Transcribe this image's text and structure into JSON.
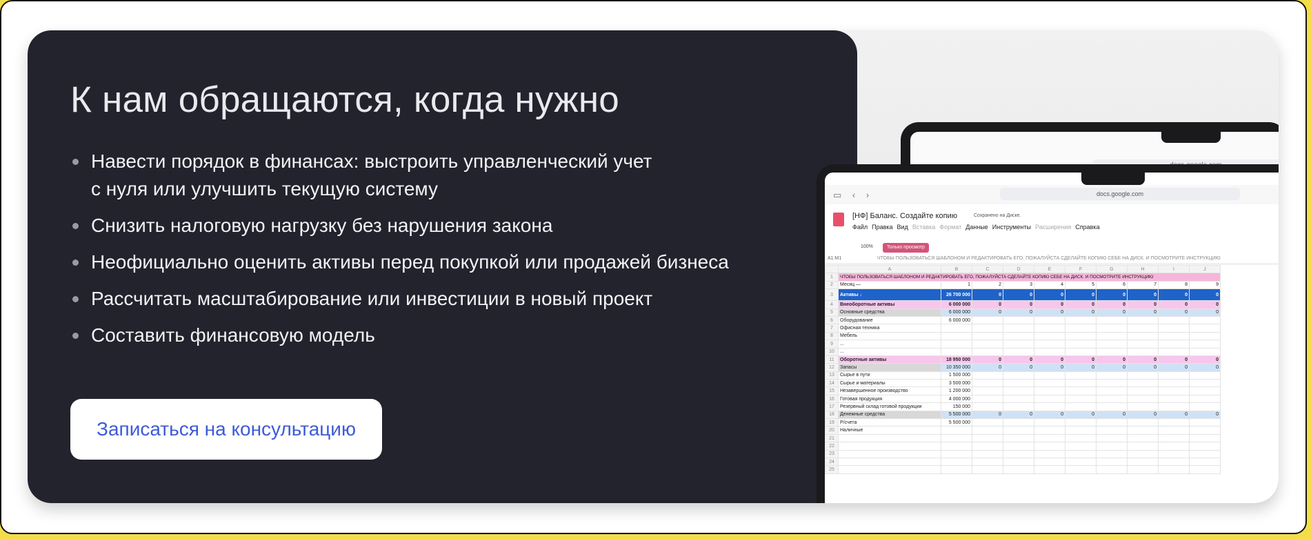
{
  "hero": {
    "title": "К нам обращаются, когда нужно",
    "bullets": [
      "Навести порядок в финансах: выстроить управленческий учет\nс нуля или улучшить текущую систему",
      "Снизить налоговую нагрузку без нарушения закона",
      "Неофициально оценить активы перед покупкой или продажей бизнеса",
      "Рассчитать масштабирование или инвестиции в новый проект",
      "Составить финансовую модель"
    ],
    "cta_label": "Записаться на консультацию"
  },
  "colors": {
    "background": "#f4dc4a",
    "panel": "#22232d",
    "cta_text": "#3d5bd8",
    "sheet_blue": "#1f63c9",
    "sheet_pink": "#f7c6ec",
    "view_only_badge": "#d4547a"
  },
  "laptop_back": {
    "url": "docs.google.com"
  },
  "spreadsheet": {
    "url": "docs.google.com",
    "doc_title": "[НФ] Баланс. Создайте копию",
    "saved_status": "Сохранено на Диске.",
    "menu": [
      "Файл",
      "Правка",
      "Вид",
      "Вставка",
      "Формат",
      "Данные",
      "Инструменты",
      "Расширения",
      "Справка"
    ],
    "zoom": "100%",
    "view_only": "Только просмотр",
    "cell_ref": "A1:M1",
    "formula_text": "ЧТОБЫ ПОЛЬЗОВАТЬСЯ ШАБЛОНОМ И РЕДАКТИРОВАТЬ ЕГО, ПОЖАЛУЙСТА СДЕЛАЙТЕ КОПИЮ СЕБЕ НА ДИСК. И ПОСМОТРИТЕ ИНСТРУКЦИЮ",
    "columns": [
      "A",
      "B",
      "C",
      "D",
      "E",
      "F",
      "G",
      "H",
      "I",
      "J"
    ],
    "banner": "ЧТОБЫ ПОЛЬЗОВАТЬСЯ ШАБЛОНОМ И РЕДАКТИРОВАТЬ ЕГО, ПОЖАЛУЙСТА СДЕЛАЙТЕ КОПИЮ СЕБЕ НА ДИСК. И ПОСМОТРИТЕ ИНСТРУКЦИЮ",
    "rows": [
      {
        "n": "2",
        "style": "month",
        "label": "Месяц —",
        "cells": [
          "1",
          "2",
          "3",
          "4",
          "5",
          "6",
          "7",
          "8",
          "9"
        ]
      },
      {
        "n": "3",
        "style": "assets",
        "label": "Активы ↓",
        "cells": [
          "26 700 000",
          "0",
          "0",
          "0",
          "0",
          "0",
          "0",
          "0",
          "0"
        ]
      },
      {
        "n": "4",
        "style": "pink",
        "label": "Внеоборотные активы",
        "cells": [
          "6 000 000",
          "0",
          "0",
          "0",
          "0",
          "0",
          "0",
          "0",
          "0"
        ]
      },
      {
        "n": "5",
        "style": "blue",
        "label": "Основные средства",
        "cells": [
          "6 000 000",
          "0",
          "0",
          "0",
          "0",
          "0",
          "0",
          "0",
          "0"
        ]
      },
      {
        "n": "6",
        "style": "plain",
        "label": "Оборудование",
        "cells": [
          "6 000 000",
          "",
          "",
          "",
          "",
          "",
          "",
          "",
          ""
        ]
      },
      {
        "n": "7",
        "style": "plain",
        "label": "Офисная техника",
        "cells": [
          "",
          "",
          "",
          "",
          "",
          "",
          "",
          "",
          ""
        ]
      },
      {
        "n": "8",
        "style": "plain",
        "label": "Мебель",
        "cells": [
          "",
          "",
          "",
          "",
          "",
          "",
          "",
          "",
          ""
        ]
      },
      {
        "n": "9",
        "style": "plain",
        "label": "...",
        "cells": [
          "",
          "",
          "",
          "",
          "",
          "",
          "",
          "",
          ""
        ]
      },
      {
        "n": "10",
        "style": "plain",
        "label": "...",
        "cells": [
          "",
          "",
          "",
          "",
          "",
          "",
          "",
          "",
          ""
        ]
      },
      {
        "n": "11",
        "style": "pink",
        "label": "Оборотные активы",
        "cells": [
          "18 950 000",
          "0",
          "0",
          "0",
          "0",
          "0",
          "0",
          "0",
          "0"
        ]
      },
      {
        "n": "12",
        "style": "blue",
        "label": "Запасы",
        "cells": [
          "10 350 000",
          "0",
          "0",
          "0",
          "0",
          "0",
          "0",
          "0",
          "0"
        ]
      },
      {
        "n": "13",
        "style": "plain",
        "label": "Сырье в пути",
        "cells": [
          "1 500 000",
          "",
          "",
          "",
          "",
          "",
          "",
          "",
          ""
        ]
      },
      {
        "n": "14",
        "style": "plain",
        "label": "Сырье и материалы",
        "cells": [
          "3 500 000",
          "",
          "",
          "",
          "",
          "",
          "",
          "",
          ""
        ]
      },
      {
        "n": "15",
        "style": "plain",
        "label": "Незавершенное производство",
        "cells": [
          "1 200 000",
          "",
          "",
          "",
          "",
          "",
          "",
          "",
          ""
        ]
      },
      {
        "n": "16",
        "style": "plain",
        "label": "Готовая продукция",
        "cells": [
          "4 000 000",
          "",
          "",
          "",
          "",
          "",
          "",
          "",
          ""
        ]
      },
      {
        "n": "17",
        "style": "plain",
        "label": "Резервный склад готовой продукции",
        "cells": [
          "150 000",
          "",
          "",
          "",
          "",
          "",
          "",
          "",
          ""
        ]
      },
      {
        "n": "18",
        "style": "blue",
        "label": "Денежные средства",
        "cells": [
          "5 500 000",
          "0",
          "0",
          "0",
          "0",
          "0",
          "0",
          "0",
          "0"
        ]
      },
      {
        "n": "19",
        "style": "plain",
        "label": "Р/счета",
        "cells": [
          "5 500 000",
          "",
          "",
          "",
          "",
          "",
          "",
          "",
          ""
        ]
      },
      {
        "n": "20",
        "style": "plain",
        "label": "Наличные",
        "cells": [
          "",
          "",
          "",
          "",
          "",
          "",
          "",
          "",
          ""
        ]
      },
      {
        "n": "21",
        "style": "plain",
        "label": "",
        "cells": [
          "",
          "",
          "",
          "",
          "",
          "",
          "",
          "",
          ""
        ]
      },
      {
        "n": "22",
        "style": "plain",
        "label": "",
        "cells": [
          "",
          "",
          "",
          "",
          "",
          "",
          "",
          "",
          ""
        ]
      },
      {
        "n": "23",
        "style": "plain",
        "label": "",
        "cells": [
          "",
          "",
          "",
          "",
          "",
          "",
          "",
          "",
          ""
        ]
      },
      {
        "n": "24",
        "style": "plain",
        "label": "",
        "cells": [
          "",
          "",
          "",
          "",
          "",
          "",
          "",
          "",
          ""
        ]
      },
      {
        "n": "25",
        "style": "plain",
        "label": "",
        "cells": [
          "",
          "",
          "",
          "",
          "",
          "",
          "",
          "",
          ""
        ]
      }
    ]
  }
}
